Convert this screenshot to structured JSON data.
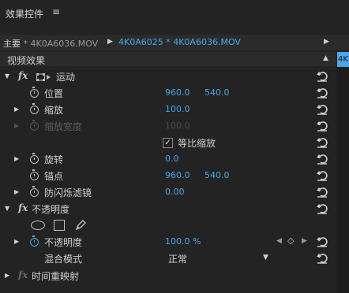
{
  "panel": {
    "title": "效果控件",
    "menu_icon": "≡"
  },
  "tabs": {
    "master_prefix": "主要",
    "master_clip": " * 4K0A6036.MOV",
    "separator": "▶",
    "clip_label": "4K0A6025 * 4K0A6036.MOV",
    "nav": "▶"
  },
  "section": {
    "label": "视频效果",
    "collapse": "▲"
  },
  "side_tag": "4K",
  "fx_glyph": "fx",
  "effects": {
    "motion": {
      "label": "运动",
      "position": {
        "label": "位置",
        "x": "960.0",
        "y": "540.0"
      },
      "scale": {
        "label": "缩放",
        "value": "100.0"
      },
      "scale_width": {
        "label": "缩放宽度",
        "value": "100.0"
      },
      "uniform_scale": {
        "label": "等比缩放",
        "check": "✓"
      },
      "rotation": {
        "label": "旋转",
        "value": "0.0"
      },
      "anchor": {
        "label": "锚点",
        "x": "960.0",
        "y": "540.0"
      },
      "anti_flicker": {
        "label": "防闪烁滤镜",
        "value": "0.00"
      }
    },
    "opacity": {
      "label": "不透明度",
      "opacity": {
        "label": "不透明度",
        "value": "100.0 %"
      },
      "blend_mode": {
        "label": "混合模式",
        "value": "正常",
        "arrow": "▼"
      }
    },
    "time_remap": {
      "label": "时间重映射"
    }
  },
  "keyframe_nav": {
    "prev": "◀",
    "add": "◇",
    "next": "▶"
  },
  "colors": {
    "accent": "#4aa8e8",
    "panel_bg": "#232323"
  }
}
